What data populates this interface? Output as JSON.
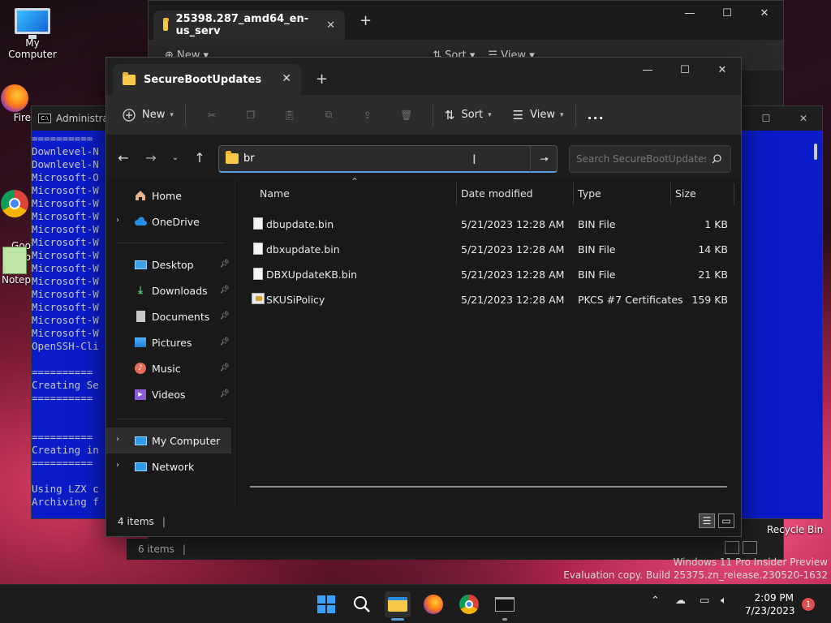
{
  "desktop": {
    "icons": [
      {
        "label": "My Computer"
      },
      {
        "label": "Fire"
      },
      {
        "label": "Goo\nChro"
      },
      {
        "label": "Notep"
      }
    ],
    "recycle_bin": "Recycle Bin",
    "watermark_line1": "Windows 11 Pro Insider Preview",
    "watermark_line2": "Evaluation copy. Build 25375.zn_release.230520-1632"
  },
  "back_window": {
    "tab_title": "25398.287_amd64_en-us_serv",
    "toolbar": {
      "new": "New",
      "sort": "Sort",
      "view": "View"
    },
    "status_items": "6 items"
  },
  "console": {
    "title": "Administrat",
    "lines": [
      "==========",
      "Downlevel-N",
      "Downlevel-N",
      "Microsoft-O",
      "Microsoft-W",
      "Microsoft-W",
      "Microsoft-W",
      "Microsoft-W",
      "Microsoft-W",
      "Microsoft-W",
      "Microsoft-W",
      "Microsoft-W",
      "Microsoft-W",
      "Microsoft-W",
      "Microsoft-W",
      "Microsoft-W",
      "OpenSSH-Cli",
      "",
      "==========",
      "Creating Se",
      "==========",
      "",
      "",
      "==========",
      "Creating in",
      "==========",
      "",
      "Using LZX c",
      "Archiving f"
    ]
  },
  "explorer": {
    "tab_title": "SecureBootUpdates",
    "toolbar": {
      "new": "New",
      "sort": "Sort",
      "view": "View",
      "more": "..."
    },
    "address_value": "br",
    "search_placeholder": "Search SecureBootUpdates",
    "nav": {
      "home": "Home",
      "onedrive": "OneDrive",
      "desktop": "Desktop",
      "downloads": "Downloads",
      "documents": "Documents",
      "pictures": "Pictures",
      "music": "Music",
      "videos": "Videos",
      "my_computer": "My Computer",
      "network": "Network"
    },
    "columns": {
      "name": "Name",
      "date": "Date modified",
      "type": "Type",
      "size": "Size"
    },
    "files": [
      {
        "name": "dbupdate.bin",
        "date": "5/21/2023 12:28 AM",
        "type": "BIN File",
        "size": "1 KB"
      },
      {
        "name": "dbxupdate.bin",
        "date": "5/21/2023 12:28 AM",
        "type": "BIN File",
        "size": "14 KB"
      },
      {
        "name": "DBXUpdateKB.bin",
        "date": "5/21/2023 12:28 AM",
        "type": "BIN File",
        "size": "21 KB"
      },
      {
        "name": "SKUSiPolicy",
        "date": "5/21/2023 12:28 AM",
        "type": "PKCS #7 Certificates",
        "size": "159 KB"
      }
    ],
    "status_items": "4 items"
  },
  "taskbar": {
    "time": "2:09 PM",
    "date": "7/23/2023",
    "notification_count": "1"
  },
  "colors": {
    "accent": "#5a9bd8",
    "console_bg": "#0a1cc8",
    "folder": "#f8c84a"
  }
}
